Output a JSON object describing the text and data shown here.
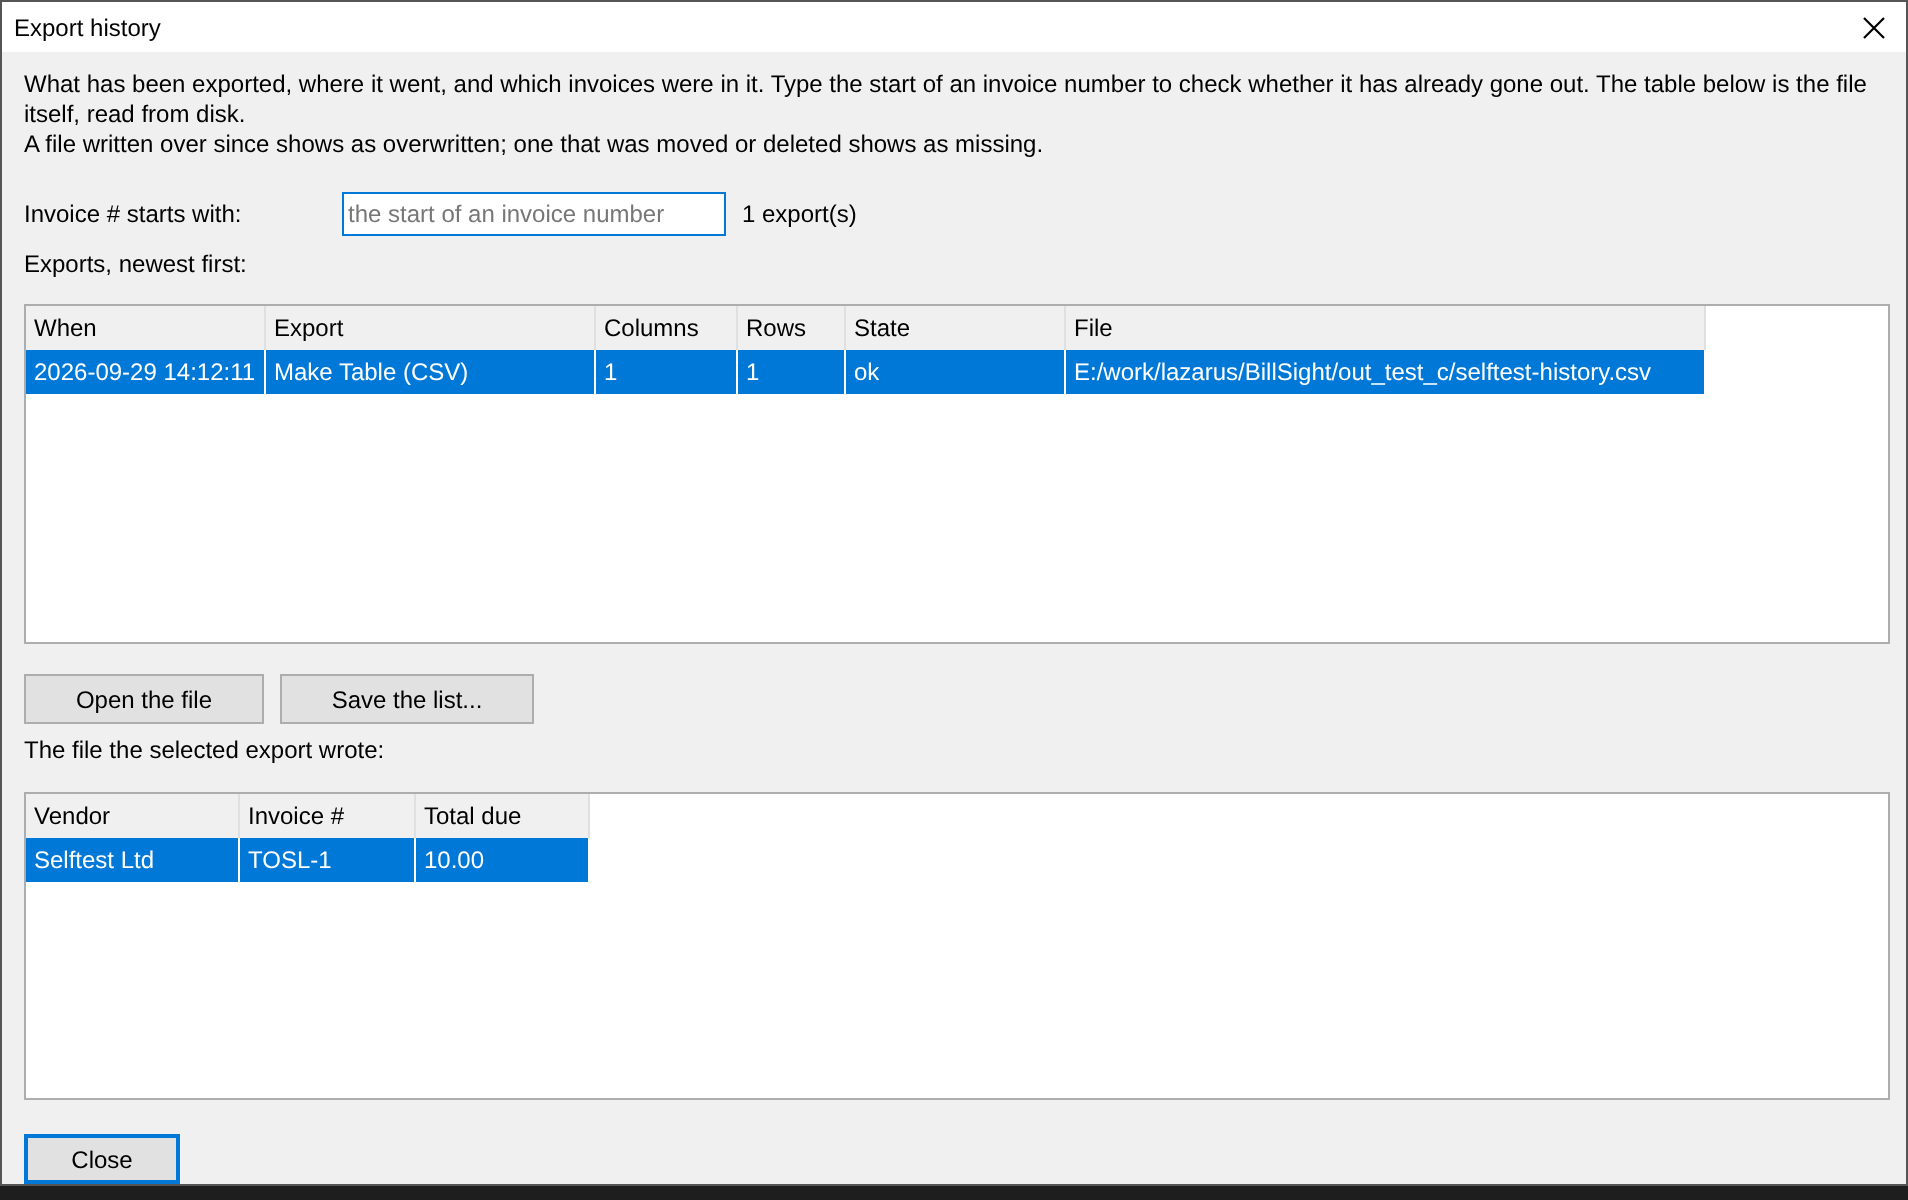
{
  "window": {
    "title": "Export history"
  },
  "intro": [
    "What has been exported, where it went, and which invoices were in it.  Type the start of an invoice number to check whether it has already gone out.  The table below is the file itself, read from disk.",
    "A file written over since shows as overwritten; one that was moved or deleted shows as missing."
  ],
  "filter": {
    "label": "Invoice # starts with:",
    "placeholder": "the start of an invoice number",
    "count": "1 export(s)"
  },
  "exports_label": "Exports, newest first:",
  "exports": {
    "columns": [
      "When",
      "Export",
      "Columns",
      "Rows",
      "State",
      "File"
    ],
    "rows": [
      {
        "selected": true,
        "cells": [
          "2026-09-29 14:12:11",
          "Make Table (CSV)",
          "1",
          "1",
          "ok",
          "E:/work/lazarus/BillSight/out_test_c/selftest-history.csv"
        ]
      }
    ]
  },
  "buttons": [
    "Open the file",
    "Save the list..."
  ],
  "file_label": "The file the selected export wrote:",
  "file": {
    "columns": [
      "Vendor",
      "Invoice #",
      "Total due"
    ],
    "rows": [
      {
        "selected": true,
        "cells": [
          "Selftest Ltd",
          "TOSL-1",
          "10.00"
        ]
      }
    ]
  },
  "close_button": "Close"
}
